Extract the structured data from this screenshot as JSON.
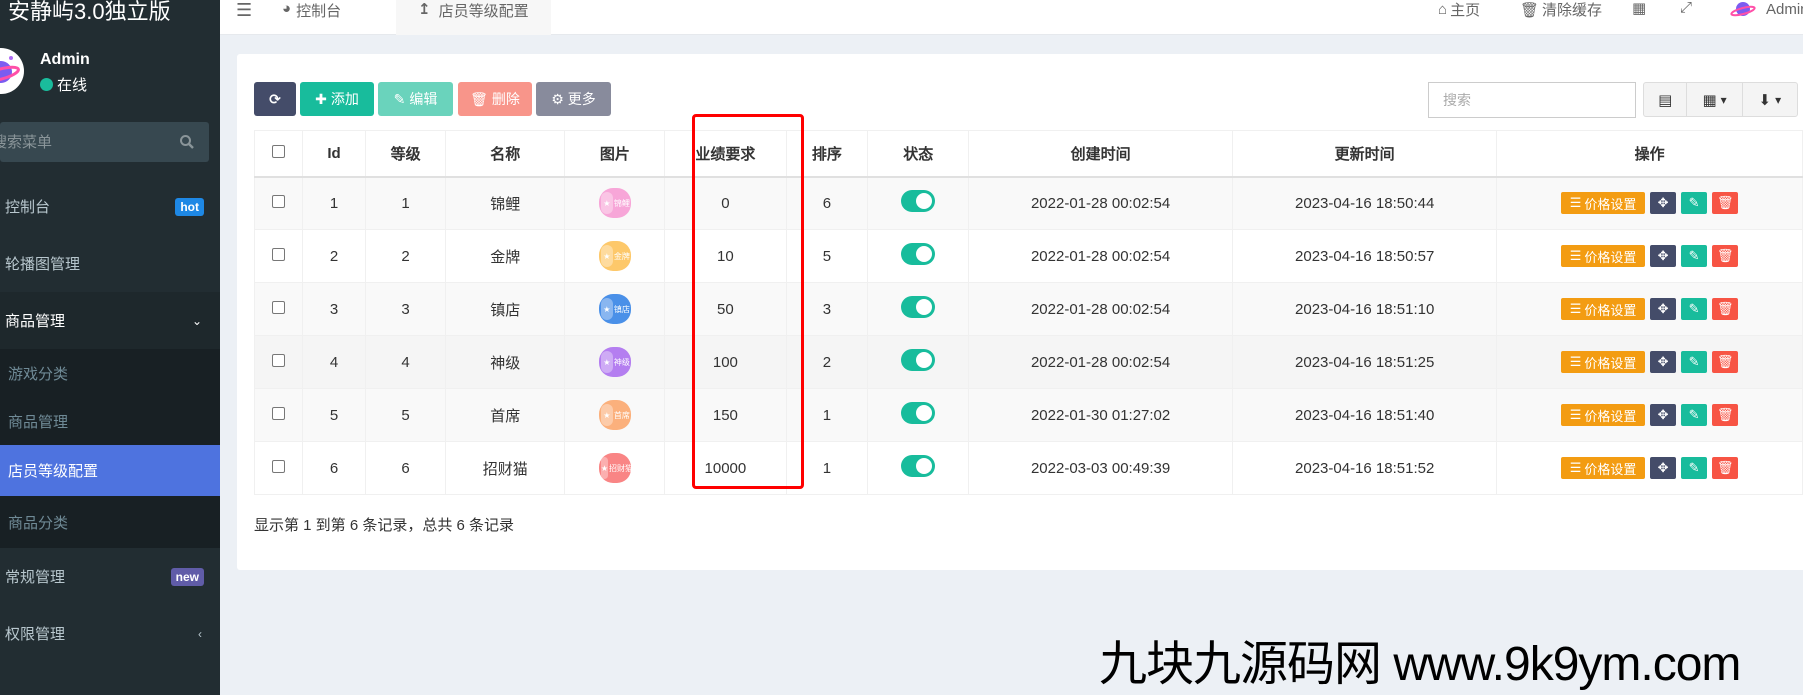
{
  "app": {
    "title": "安静屿3.0独立版"
  },
  "user": {
    "name": "Admin",
    "status": "在线"
  },
  "sidebar": {
    "search_placeholder": "搜索菜单",
    "items": [
      {
        "label": "控制台",
        "badge": "hot",
        "badge_color": "#1e88e5"
      },
      {
        "label": "轮播图管理"
      },
      {
        "label": "商品管理",
        "expanded": true,
        "children": [
          {
            "label": "游戏分类"
          },
          {
            "label": "商品管理"
          },
          {
            "label": "店员等级配置",
            "active": true
          },
          {
            "label": "商品分类"
          }
        ]
      },
      {
        "label": "常规管理",
        "badge": "new",
        "badge_color": "#605ca8"
      },
      {
        "label": "权限管理"
      }
    ]
  },
  "topbar": {
    "tabs": [
      {
        "label": "控制台",
        "icon": "dashboard-icon"
      },
      {
        "label": "店员等级配置",
        "icon": "level-up-icon",
        "active": true
      }
    ],
    "right": {
      "home": "主页",
      "clear_cache": "清除缓存",
      "user": "Admin"
    }
  },
  "toolbar": {
    "refresh_label": "",
    "add_label": "添加",
    "edit_label": "编辑",
    "delete_label": "删除",
    "more_label": "更多",
    "search_placeholder": "搜索",
    "colors": {
      "refresh": "#444c69",
      "add": "#18bc9c",
      "edit": "#6ad3bc",
      "delete": "#f8958a",
      "more": "#888b9c"
    }
  },
  "table": {
    "columns": [
      "",
      "Id",
      "等级",
      "名称",
      "图片",
      "业绩要求",
      "排序",
      "状态",
      "创建时间",
      "更新时间",
      "操作"
    ],
    "rows": [
      {
        "id": "1",
        "level": "1",
        "name": "锦鲤",
        "image_text": "锦鲤",
        "image_color": "#f7a6d8",
        "requirement": "0",
        "sort": "6",
        "status": true,
        "created": "2022-01-28 00:02:54",
        "updated": "2023-04-16 18:50:44"
      },
      {
        "id": "2",
        "level": "2",
        "name": "金牌",
        "image_text": "金牌",
        "image_color": "#fdc86a",
        "requirement": "10",
        "sort": "5",
        "status": true,
        "created": "2022-01-28 00:02:54",
        "updated": "2023-04-16 18:50:57"
      },
      {
        "id": "3",
        "level": "3",
        "name": "镇店",
        "image_text": "镇店",
        "image_color": "#4a90e8",
        "requirement": "50",
        "sort": "3",
        "status": true,
        "created": "2022-01-28 00:02:54",
        "updated": "2023-04-16 18:51:10"
      },
      {
        "id": "4",
        "level": "4",
        "name": "神级",
        "image_text": "神级",
        "image_color": "#b47ef0",
        "requirement": "100",
        "sort": "2",
        "status": true,
        "created": "2022-01-28 00:02:54",
        "updated": "2023-04-16 18:51:25"
      },
      {
        "id": "5",
        "level": "5",
        "name": "首席",
        "image_text": "首席",
        "image_color": "#fbb07c",
        "requirement": "150",
        "sort": "1",
        "status": true,
        "created": "2022-01-30 01:27:02",
        "updated": "2023-04-16 18:51:40"
      },
      {
        "id": "6",
        "level": "6",
        "name": "招财猫",
        "image_text": "招财猫",
        "image_color": "#f98585",
        "requirement": "10000",
        "sort": "1",
        "status": true,
        "created": "2022-03-03 00:49:39",
        "updated": "2023-04-16 18:51:52"
      }
    ],
    "row_actions": {
      "price_label": "价格设置"
    }
  },
  "pagination": {
    "summary": "显示第 1 到第 6 条记录，总共 6 条记录"
  },
  "watermark": "九块九源码网 www.9k9ym.com"
}
